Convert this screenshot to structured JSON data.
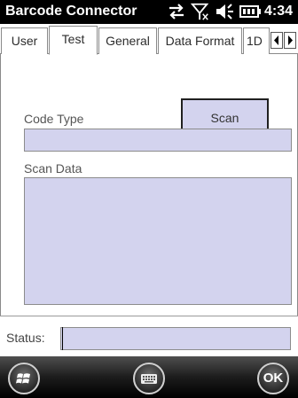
{
  "titlebar": {
    "title": "Barcode Connector",
    "time": "4:34",
    "icons": [
      "connectivity-arrows-icon",
      "no-signal-icon",
      "volume-icon",
      "battery-icon"
    ]
  },
  "tabs": {
    "items": [
      {
        "label": "User",
        "active": false
      },
      {
        "label": "Test",
        "active": true
      },
      {
        "label": "General",
        "active": false
      },
      {
        "label": "Data Format",
        "active": false
      },
      {
        "label": "1D",
        "active": false
      }
    ],
    "scroll_icons": [
      "arrow-left-icon",
      "arrow-right-icon"
    ]
  },
  "test": {
    "scan_label": "Scan",
    "code_type_label": "Code Type",
    "code_type_value": "",
    "scan_data_label": "Scan Data",
    "scan_data_value": ""
  },
  "status": {
    "label": "Status:",
    "value": ""
  },
  "menubar": {
    "ok_label": "OK",
    "icons": [
      "windows-start-icon",
      "keyboard-icon",
      "ok-icon"
    ]
  },
  "colors": {
    "field_fill": "#d3d3ee",
    "bar_background": "#000000"
  }
}
